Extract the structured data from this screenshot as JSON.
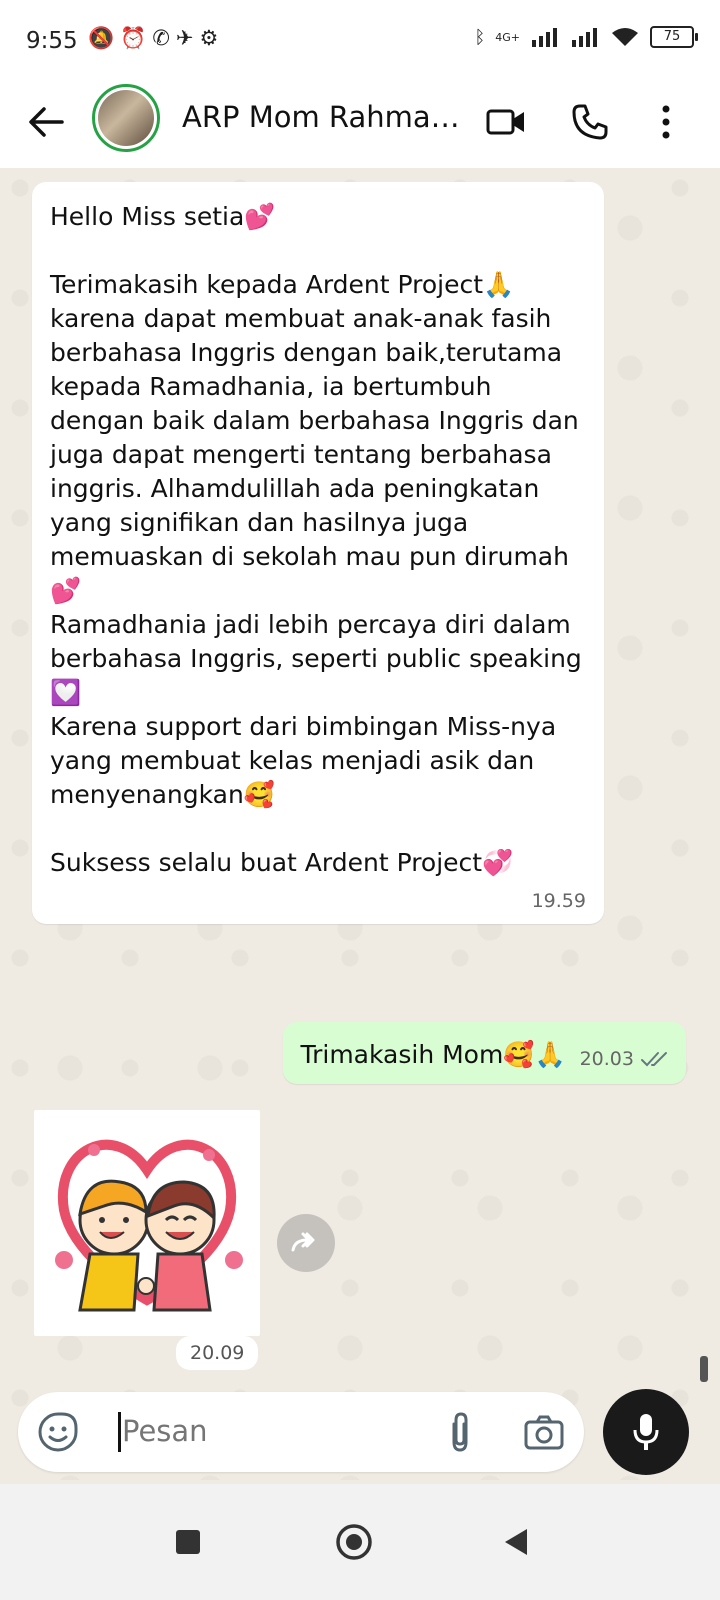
{
  "status_bar": {
    "time": "9:55",
    "left_icons": [
      "mute-icon",
      "alarm-icon",
      "whatsapp-icon",
      "send-icon",
      "gear-icon"
    ],
    "network": "4G+",
    "battery": "75"
  },
  "header": {
    "title": "ARP Mom Rahmad…",
    "buttons": [
      "video-call",
      "voice-call",
      "more-options"
    ]
  },
  "messages": [
    {
      "direction": "incoming",
      "text": "Hello Miss setia💕\n\nTerimakasih kepada Ardent Project🙏\nkarena dapat membuat anak-anak fasih berbahasa Inggris dengan baik,terutama kepada Ramadhania, ia bertumbuh dengan baik dalam berbahasa Inggris dan juga dapat mengerti tentang berbahasa inggris. Alhamdulillah ada peningkatan yang signifikan dan hasilnya juga memuaskan di sekolah mau pun dirumah💕\nRamadhania jadi lebih percaya diri dalam berbahasa Inggris, seperti public speaking💟\nKarena support dari bimbingan Miss-nya yang membuat kelas menjadi asik dan menyenangkan🥰\n\nSuksess selalu buat Ardent Project💞",
      "time": "19.59"
    },
    {
      "direction": "outgoing",
      "text": "Trimakasih Mom🥰🙏",
      "time": "20.03",
      "status": "read"
    },
    {
      "direction": "incoming",
      "type": "sticker",
      "time": "20.09"
    }
  ],
  "input": {
    "placeholder": "Pesan"
  },
  "colors": {
    "chat_bg": "#efeae2",
    "incoming_bubble": "#ffffff",
    "outgoing_bubble": "#d9fdd3",
    "avatar_ring": "#25a244",
    "read_ticks": "#8696a0"
  }
}
